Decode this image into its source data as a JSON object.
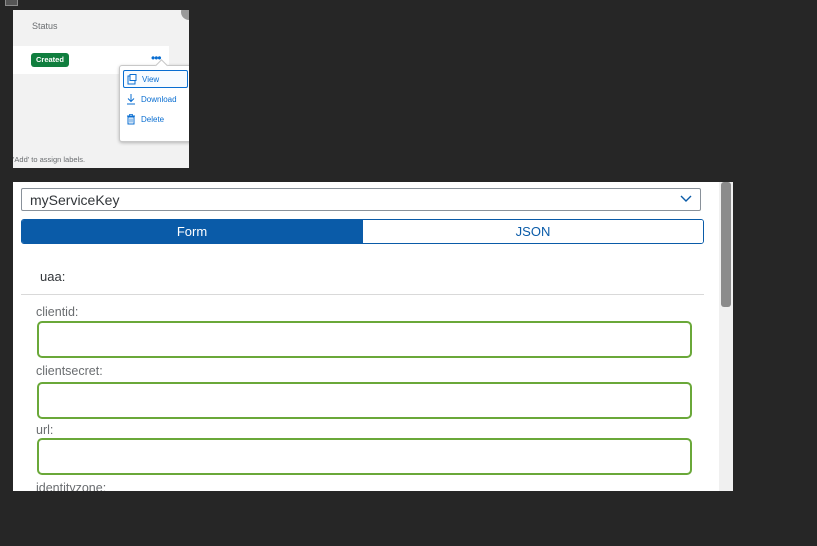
{
  "thumbnail": {
    "status_label": "Status",
    "badge": "Created",
    "badge_color": "#107e3e",
    "more_icon": "ellipsis-icon",
    "menu": [
      {
        "label": "View",
        "icon": "view-icon"
      },
      {
        "label": "Download",
        "icon": "download-icon"
      },
      {
        "label": "Delete",
        "icon": "trash-icon"
      }
    ],
    "hint": "'Add' to assign labels."
  },
  "service_key": {
    "selected": "myServiceKey"
  },
  "tabs": [
    {
      "label": "Form",
      "active": true
    },
    {
      "label": "JSON",
      "active": false
    }
  ],
  "form": {
    "section": "uaa:",
    "fields": [
      {
        "label": "clientid:",
        "value": ""
      },
      {
        "label": "clientsecret:",
        "value": ""
      },
      {
        "label": "url:",
        "value": ""
      },
      {
        "label": "identityzone:",
        "value": ""
      }
    ]
  },
  "colors": {
    "accent": "#0a5ba8",
    "field_border": "#6aa839",
    "background": "#262626"
  }
}
